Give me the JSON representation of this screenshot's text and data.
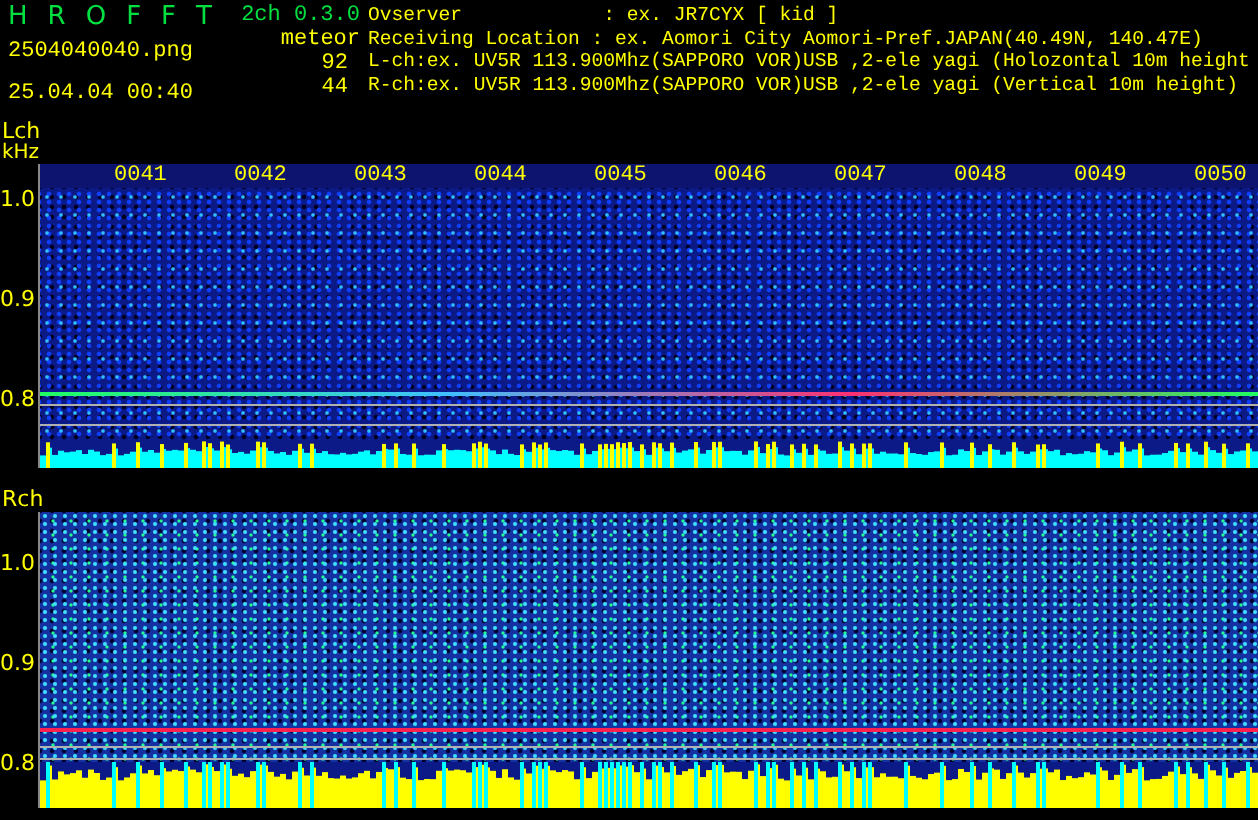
{
  "header": {
    "title_letters": [
      "H",
      "R",
      "O",
      "F",
      "F",
      "T"
    ],
    "version": "2ch 0.3.0",
    "filename": "2504040040.png",
    "timestamp": "25.04.04 00:40",
    "count_label": "meteor",
    "counts": [
      "92",
      "44"
    ],
    "info_lines": [
      "Ovserver            : ex. JR7CYX [ kid ]",
      "Receiving Location : ex. Aomori City Aomori-Pref.JAPAN(40.49N, 140.47E)",
      "L-ch:ex. UV5R 113.900Mhz(SAPPORO VOR)USB ,2-ele yagi (Holozontal 10m height",
      "R-ch:ex. UV5R 113.900Mhz(SAPPORO VOR)USB ,2-ele yagi (Vertical 10m height)"
    ]
  },
  "channels": [
    {
      "label": "Lch",
      "unit": "kHz",
      "kind": "lch",
      "y_ticks": [
        "1.0",
        "0.9",
        "0.8"
      ],
      "time_labels": [
        "0041",
        "0042",
        "0043",
        "0044",
        "0045",
        "0046",
        "0047",
        "0048",
        "0049",
        "0050"
      ]
    },
    {
      "label": "Rch",
      "kind": "rch",
      "y_ticks": [
        "1.0",
        "0.9",
        "0.8"
      ]
    }
  ]
}
